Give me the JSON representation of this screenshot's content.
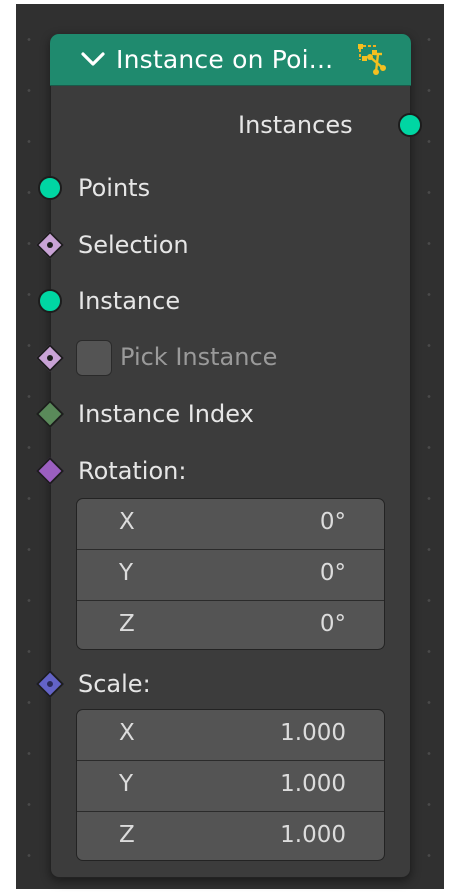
{
  "node": {
    "title": "Instance on Poi...",
    "header_icon": "point-instance-icon",
    "collapse_icon": "chevron-down-icon",
    "colors": {
      "header": "#1f8a6e",
      "geometry_socket": "#00d6a3",
      "boolean_socket": "#c9a3d6",
      "int_socket": "#5a8a5a",
      "vector_socket": "#9b5fc0",
      "float_vector_socket": "#6363c7"
    }
  },
  "output": {
    "instances": "Instances"
  },
  "inputs": {
    "points": "Points",
    "selection": "Selection",
    "instance": "Instance",
    "pick_instance": "Pick Instance",
    "instance_index": "Instance Index",
    "rotation": "Rotation:",
    "scale": "Scale:"
  },
  "rotation": [
    {
      "axis": "X",
      "value": "0°"
    },
    {
      "axis": "Y",
      "value": "0°"
    },
    {
      "axis": "Z",
      "value": "0°"
    }
  ],
  "scale": [
    {
      "axis": "X",
      "value": "1.000"
    },
    {
      "axis": "Y",
      "value": "1.000"
    },
    {
      "axis": "Z",
      "value": "1.000"
    }
  ]
}
